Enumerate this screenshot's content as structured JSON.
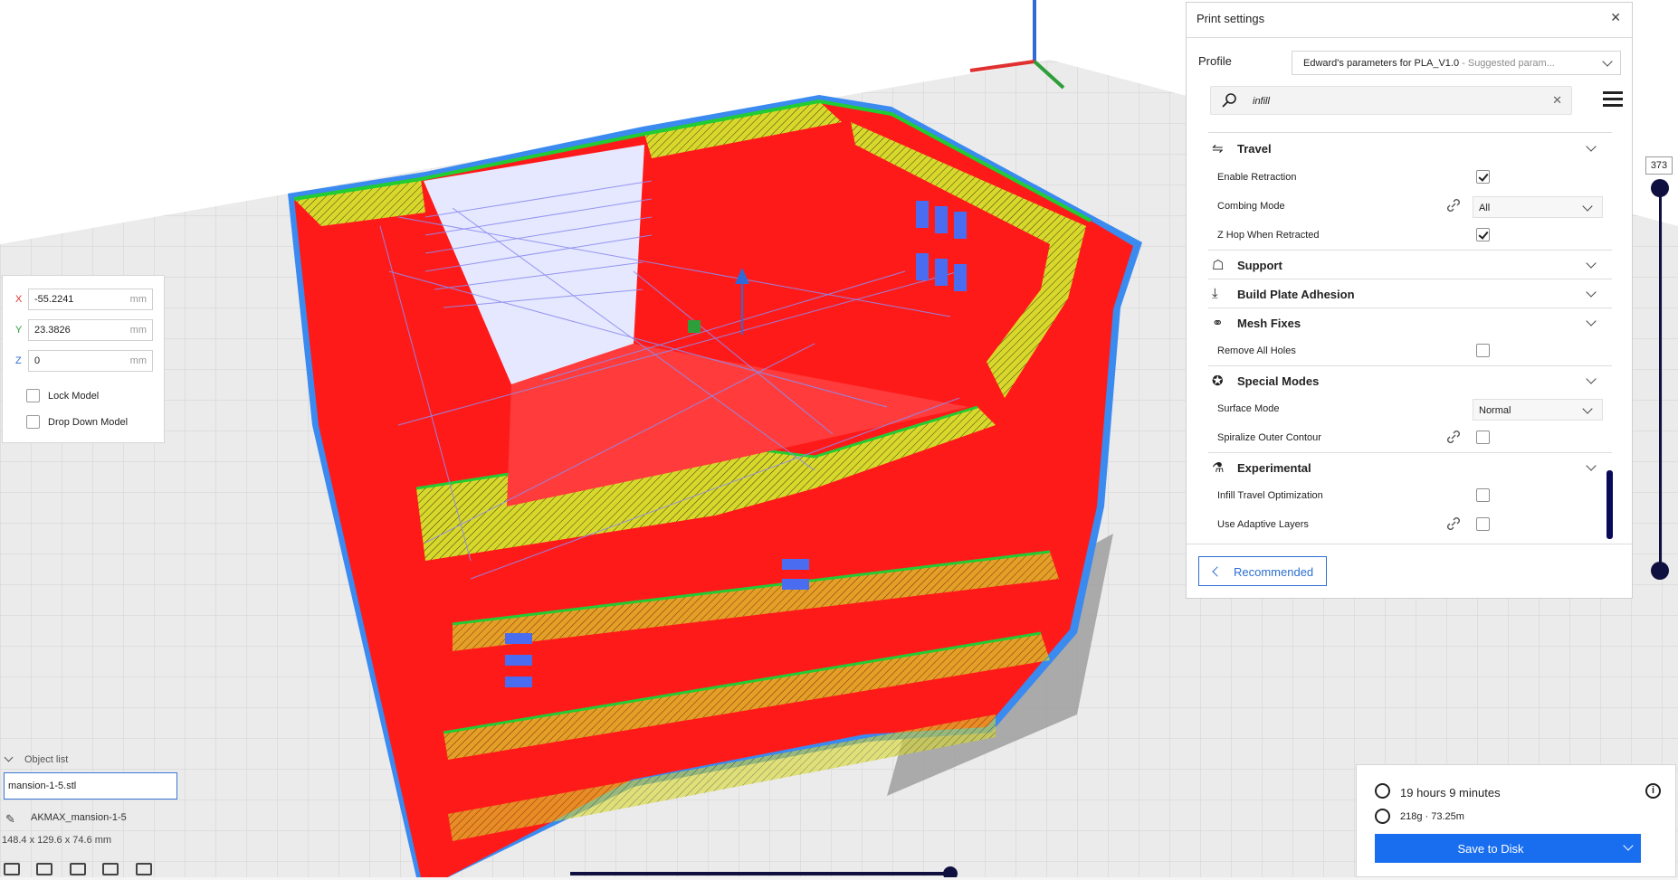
{
  "move_tool": {
    "x_label": "X",
    "x_value": "-55.2241",
    "x_unit": "mm",
    "y_label": "Y",
    "y_value": "23.3826",
    "y_unit": "mm",
    "z_label": "Z",
    "z_value": "0",
    "z_unit": "mm",
    "lock_model_label": "Lock Model",
    "drop_down_model_label": "Drop Down Model",
    "axis_colors": {
      "x": "#e03030",
      "y": "#2e9e3a",
      "z": "#2f6bd8"
    }
  },
  "object_list": {
    "heading": "Object list",
    "file_name": "mansion-1-5.stl",
    "object_name": "AKMAX_mansion-1-5",
    "dimensions": "148.4 x 129.6 x 74.6 mm"
  },
  "print_settings": {
    "title": "Print settings",
    "profile_label": "Profile",
    "profile_name": "Edward's parameters for PLA_V1.0",
    "profile_suffix": " - Suggested param...",
    "search_value": "infill",
    "categories": {
      "travel": "Travel",
      "support": "Support",
      "adhesion": "Build Plate Adhesion",
      "mesh_fixes": "Mesh Fixes",
      "special_modes": "Special Modes",
      "experimental": "Experimental"
    },
    "settings": {
      "enable_retraction": "Enable Retraction",
      "combing_mode": "Combing Mode",
      "combing_mode_value": "All",
      "z_hop": "Z Hop When Retracted",
      "remove_all_holes": "Remove All Holes",
      "surface_mode": "Surface Mode",
      "surface_mode_value": "Normal",
      "spiralize": "Spiralize Outer Contour",
      "infill_travel_opt": "Infill Travel Optimization",
      "use_adaptive_layers": "Use Adaptive Layers"
    },
    "recommended_button": "Recommended"
  },
  "layer_slider": {
    "current_layer": "373"
  },
  "print_info": {
    "time": "19 hours 9 minutes",
    "material": "218g · 73.25m",
    "save_button": "Save to Disk"
  },
  "colors": {
    "accent": "#196ef0",
    "model_red": "#ff1a1a",
    "infill_yellow": "#d9d92a",
    "wall_green": "#22cc33",
    "travel_blue": "#8c8cf0",
    "outline_blue": "#3a8af0"
  }
}
